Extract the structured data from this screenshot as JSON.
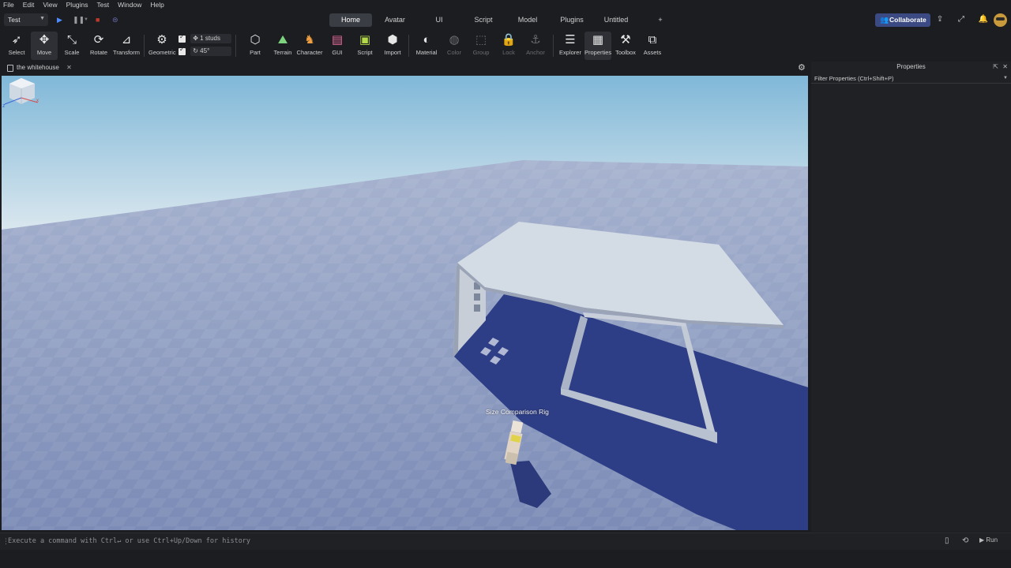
{
  "menu": [
    "File",
    "Edit",
    "View",
    "Plugins",
    "Test",
    "Window",
    "Help"
  ],
  "mode": {
    "value": "Test"
  },
  "tabs": [
    {
      "label": "Home",
      "active": true
    },
    {
      "label": "Avatar",
      "active": false
    },
    {
      "label": "UI",
      "active": false
    },
    {
      "label": "Script",
      "active": false
    },
    {
      "label": "Model",
      "active": false
    },
    {
      "label": "Plugins",
      "active": false
    },
    {
      "label": "Untitled",
      "active": false
    },
    {
      "label": "+",
      "active": false
    }
  ],
  "collaborate": "Collaborate",
  "toolbar": {
    "select": "Select",
    "move": "Move",
    "scale": "Scale",
    "rotate": "Rotate",
    "transform": "Transform",
    "geometric": "Geometric",
    "move_snap": "1 studs",
    "rotate_snap": "45°",
    "part": "Part",
    "terrain": "Terrain",
    "character": "Character",
    "gui": "GUI",
    "script": "Script",
    "import": "Import",
    "material": "Material",
    "color": "Color",
    "group": "Group",
    "lock": "Lock",
    "anchor": "Anchor",
    "explorer": "Explorer",
    "properties": "Properties",
    "toolbox": "Toolbox",
    "assets": "Assets"
  },
  "document": {
    "tab": "the whitehouse"
  },
  "viewport": {
    "rig_label": "Size Comparison Rig"
  },
  "properties": {
    "title": "Properties",
    "filter_placeholder": "Filter Properties (Ctrl+Shift+P)"
  },
  "command": {
    "placeholder": "Execute a command with Ctrl↵ or use Ctrl+Up/Down for history",
    "run": "Run"
  },
  "colors": {
    "accent": "#3b4a82",
    "sky_top": "#7fb6d6",
    "sky_bottom": "#dbe7ef",
    "baseplate": "#8d9cc0",
    "shadow": "#2f3f86"
  }
}
